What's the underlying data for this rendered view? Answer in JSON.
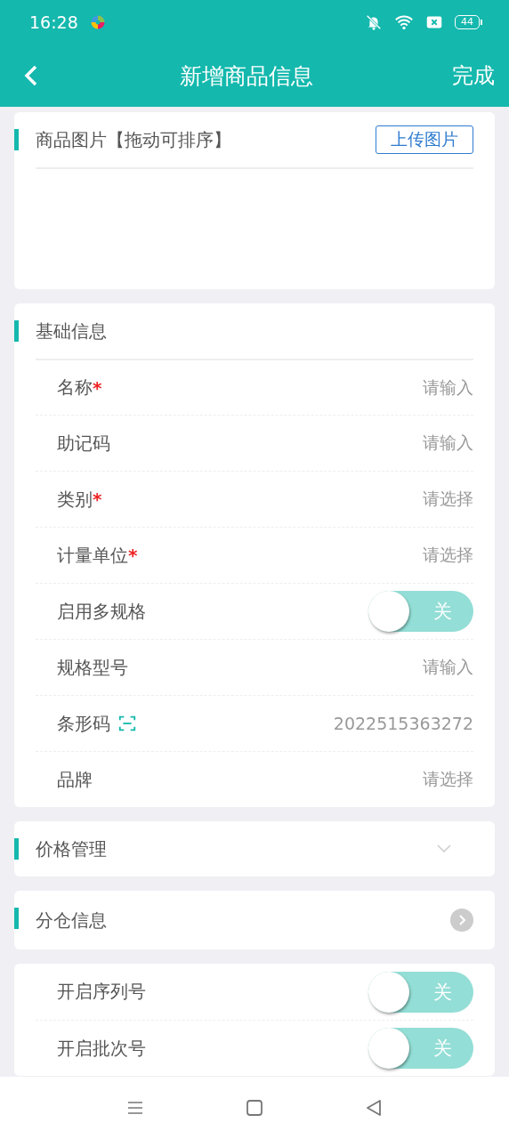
{
  "status_bar": {
    "time": "16:28",
    "battery": "44"
  },
  "header": {
    "title": "新增商品信息",
    "action": "完成"
  },
  "images_section": {
    "title": "商品图片【拖动可排序】",
    "upload_button": "上传图片"
  },
  "basic_section": {
    "title": "基础信息",
    "rows": [
      {
        "kind": "input",
        "label": "名称",
        "mark": "*",
        "placeholder": "请输入"
      },
      {
        "kind": "input",
        "label": "助记码",
        "placeholder": "请输入"
      },
      {
        "kind": "select",
        "label": "类别",
        "mark": "*",
        "placeholder": "请选择"
      },
      {
        "kind": "select",
        "label": "计量单位",
        "mark": "*",
        "placeholder": "请选择"
      },
      {
        "kind": "toggle",
        "label": "启用多规格",
        "on": false,
        "state_text": "关"
      },
      {
        "kind": "input",
        "label": "规格型号",
        "placeholder": "请输入"
      },
      {
        "kind": "barcode",
        "label": "条形码",
        "value": "2022515363272"
      },
      {
        "kind": "select",
        "label": "品牌",
        "placeholder": "请选择"
      }
    ]
  },
  "price_section": {
    "title": "价格管理",
    "expanded": false
  },
  "warehouse_section": {
    "title": "分仓信息"
  },
  "options_section": {
    "rows": [
      {
        "kind": "toggle",
        "label": "开启序列号",
        "on": false,
        "state_text": "关"
      },
      {
        "kind": "toggle",
        "label": "开启批次号",
        "on": false,
        "state_text": "关"
      }
    ]
  }
}
